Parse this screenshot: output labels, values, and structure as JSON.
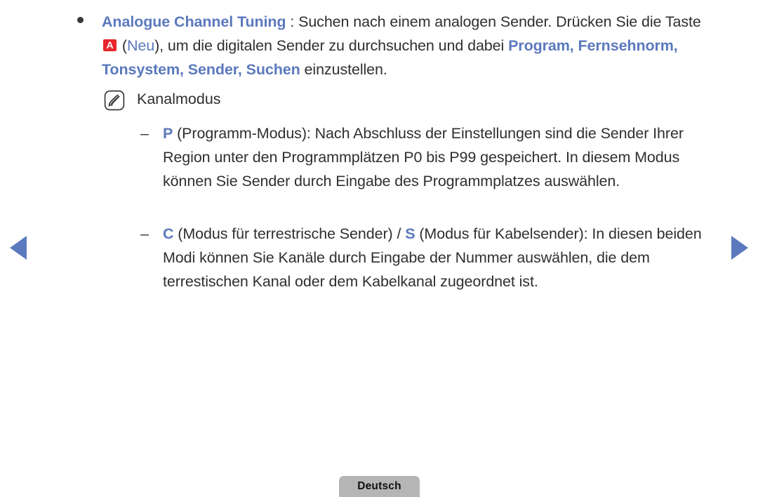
{
  "page": {
    "language_button": "Deutsch",
    "accent_blue": "#5b79bd",
    "key_red": "#e8252c",
    "text_color": "#2f2f2f"
  },
  "nav": {
    "prev_label": "◀",
    "next_label": "▶"
  },
  "bullet": {
    "marker": "•",
    "title": "Analogue Channel Tuning",
    "after_title": " : Suchen nach einem analogen Sender. Drücken Sie die Taste ",
    "key_badge": "A",
    "paren_open": " (",
    "key_name": "Neu",
    "after_key": "), um die digitalen Sender zu durchsuchen und dabei ",
    "menu_path": "Program, Fernsehnorm, Tonsystem, Sender, Suchen",
    "tail": " einzustellen."
  },
  "note": {
    "icon": "note-pen-icon",
    "label": "Kanalmodus"
  },
  "dash_items": [
    {
      "marker": "–",
      "code": "P",
      "text": " (Programm-Modus): Nach Abschluss der Einstellungen sind die Sender Ihrer Region unter den Programmplätzen P0 bis P99 gespeichert. In diesem Modus können Sie Sender durch Eingabe des Programmplatzes auswählen."
    },
    {
      "marker": "–",
      "code": "C",
      "mid_text": " (Modus für terrestrische Sender) / ",
      "code2": "S",
      "text": " (Modus für Kabelsender): In diesen beiden Modi können Sie Kanäle durch Eingabe der Nummer auswählen, die dem terrestischen Kanal oder dem Kabelkanal zugeordnet ist."
    }
  ]
}
